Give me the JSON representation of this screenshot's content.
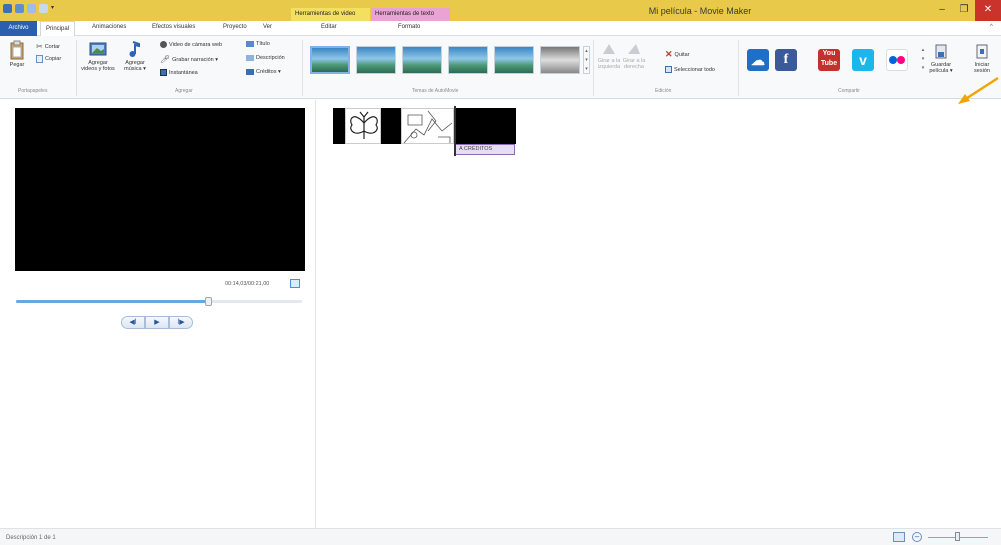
{
  "window": {
    "title": "Mi película - Movie Maker",
    "context_tab_video": "Herramientas de video",
    "context_tab_text": "Herramientas de texto",
    "minimize": "–",
    "maximize": "❐",
    "close": "✕"
  },
  "tabs": {
    "file": "Archivo",
    "home": "Principal",
    "animations": "Animaciones",
    "visual_effects": "Efectos visuales",
    "project": "Proyecto",
    "view": "Ver",
    "edit": "Editar",
    "format": "Formato"
  },
  "ribbon": {
    "clipboard": {
      "paste": "Pegar",
      "cut": "Cortar",
      "copy": "Copiar",
      "label": "Portapapeles"
    },
    "add": {
      "add_videos": "Agregar videos y fotos",
      "add_music": "Agregar música ▾",
      "webcam": "Video de cámara web",
      "narration": "Grabar narración ▾",
      "snapshot": "Instantánea",
      "title": "Título",
      "caption": "Descripción",
      "credits": "Créditos ▾",
      "label": "Agregar"
    },
    "themes": {
      "label": "Temas de AutoMovie"
    },
    "editing": {
      "rotate_left": "Girar a la izquierda",
      "rotate_right": "Girar a la derecha",
      "remove": "Quitar",
      "select_all": "Seleccionar todo",
      "label": "Edición"
    },
    "share": {
      "label": "Compartir",
      "save_movie": "Guardar película ▾",
      "sign_in": "Iniciar sesión"
    }
  },
  "preview": {
    "time": "00:14,03/00:21,00",
    "progress": 0.67
  },
  "storyboard": {
    "credits_label": "A CRÉDITOS"
  },
  "statusbar": {
    "description": "Descripción 1 de 1"
  }
}
